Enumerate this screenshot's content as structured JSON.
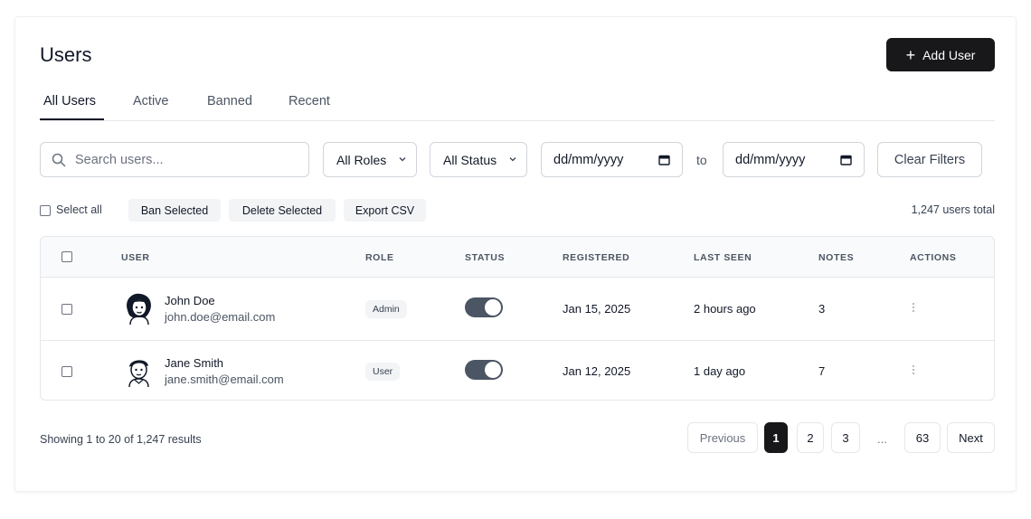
{
  "header": {
    "title": "Users",
    "add_button_label": "Add User",
    "add_icon": "plus-icon"
  },
  "tabs": [
    {
      "label": "All Users",
      "active": true
    },
    {
      "label": "Active",
      "active": false
    },
    {
      "label": "Banned",
      "active": false
    },
    {
      "label": "Recent",
      "active": false
    }
  ],
  "filters": {
    "search_placeholder": "Search users...",
    "role_select": "All Roles",
    "status_select": "All Status",
    "date_from": "dd/mm/yyyy",
    "date_separator": "to",
    "date_to": "dd/mm/yyyy",
    "clear_label": "Clear Filters"
  },
  "bulk": {
    "select_all_label": "Select all",
    "ban_label": "Ban Selected",
    "delete_label": "Delete Selected",
    "export_label": "Export CSV",
    "total_label": "1,247 users total"
  },
  "table": {
    "headers": [
      "USER",
      "ROLE",
      "STATUS",
      "REGISTERED",
      "LAST SEEN",
      "NOTES",
      "ACTIONS"
    ],
    "rows": [
      {
        "name": "John Doe",
        "email": "john.doe@email.com",
        "role": "Admin",
        "status_on": true,
        "registered": "Jan 15, 2025",
        "last_seen": "2 hours ago",
        "notes": "3"
      },
      {
        "name": "Jane Smith",
        "email": "jane.smith@email.com",
        "role": "User",
        "status_on": true,
        "registered": "Jan 12, 2025",
        "last_seen": "1 day ago",
        "notes": "7"
      }
    ]
  },
  "pagination": {
    "summary": "Showing 1 to 20 of 1,247 results",
    "previous": "Previous",
    "pages": [
      "1",
      "2",
      "3"
    ],
    "ellipsis": "...",
    "last_page": "63",
    "next": "Next",
    "current": "1"
  },
  "colors": {
    "primary": "#18181b",
    "toggle_on": "#4b5563",
    "border": "#e5e7eb",
    "muted_text": "#4b5563"
  }
}
